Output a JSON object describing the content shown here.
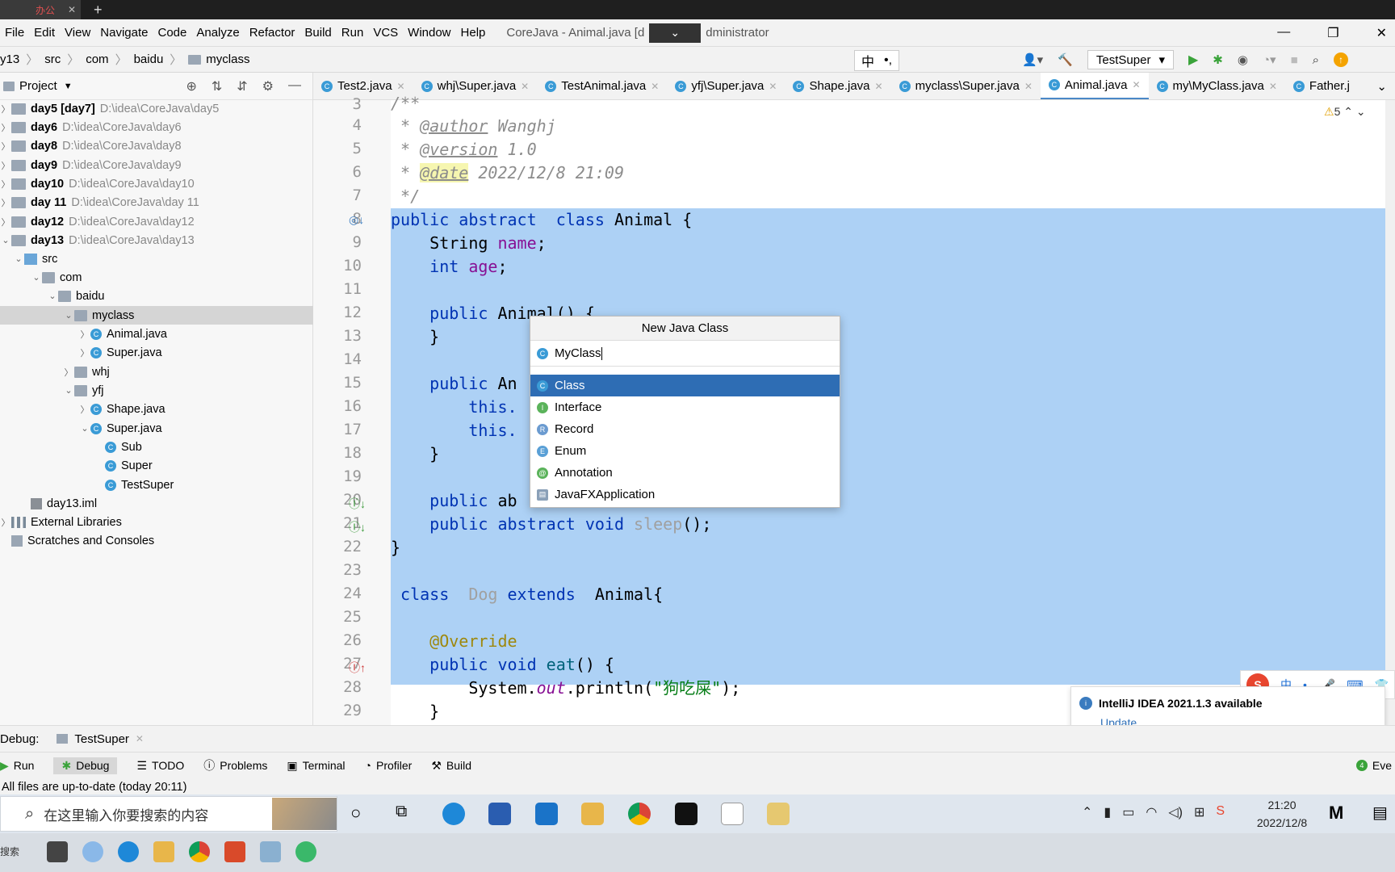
{
  "browser": {
    "tab_label": "办公",
    "new_tab": "+"
  },
  "menu": {
    "items": [
      "File",
      "Edit",
      "View",
      "Navigate",
      "Code",
      "Analyze",
      "Refactor",
      "Build",
      "Run",
      "VCS",
      "Window",
      "Help"
    ],
    "window_title_left": "CoreJava - Animal.java [d",
    "window_title_right": "dministrator"
  },
  "nav": {
    "breadcrumb": [
      "y13",
      "src",
      "com",
      "baidu",
      "myclass"
    ],
    "ime_zh": "中",
    "ime_punct": "•,",
    "run_config": "TestSuper"
  },
  "project": {
    "title": "Project",
    "tree": [
      {
        "name": "day5 [day7]",
        "path": "D:\\idea\\CoreJava\\day5",
        "bold": true
      },
      {
        "name": "day6",
        "path": "D:\\idea\\CoreJava\\day6",
        "bold": true
      },
      {
        "name": "day8",
        "path": "D:\\idea\\CoreJava\\day8",
        "bold": true
      },
      {
        "name": "day9",
        "path": "D:\\idea\\CoreJava\\day9",
        "bold": true
      },
      {
        "name": "day10",
        "path": "D:\\idea\\CoreJava\\day10",
        "bold": true
      },
      {
        "name": "day 11",
        "path": "D:\\idea\\CoreJava\\day 11",
        "bold": true
      },
      {
        "name": "day12",
        "path": "D:\\idea\\CoreJava\\day12",
        "bold": true
      },
      {
        "name": "day13",
        "path": "D:\\idea\\CoreJava\\day13",
        "bold": true
      },
      {
        "name": "src"
      },
      {
        "name": "com"
      },
      {
        "name": "baidu"
      },
      {
        "name": "myclass"
      },
      {
        "name": "Animal.java"
      },
      {
        "name": "Super.java"
      },
      {
        "name": "whj"
      },
      {
        "name": "yfj"
      },
      {
        "name": "Shape.java"
      },
      {
        "name": "Super.java"
      },
      {
        "name": "Sub"
      },
      {
        "name": "Super"
      },
      {
        "name": "TestSuper"
      },
      {
        "name": "day13.iml"
      },
      {
        "name": "External Libraries"
      },
      {
        "name": "Scratches and Consoles"
      }
    ]
  },
  "tabs": [
    "Test2.java",
    "whj\\Super.java",
    "TestAnimal.java",
    "yfj\\Super.java",
    "Shape.java",
    "myclass\\Super.java",
    "Animal.java",
    "my\\MyClass.java",
    "Father.j"
  ],
  "editor": {
    "warning_count": "5",
    "line_numbers": [
      "3",
      "4",
      "5",
      "6",
      "7",
      "8",
      "9",
      "10",
      "11",
      "12",
      "13",
      "14",
      "15",
      "16",
      "17",
      "18",
      "19",
      "20",
      "21",
      "22",
      "23",
      "24",
      "25",
      "26",
      "27",
      "28",
      "29"
    ],
    "c3": "/**",
    "c4a": " * ",
    "c4tag": "@author",
    "c4b": " Wanghj",
    "c5a": " * ",
    "c5tag": "@version",
    "c5b": " 1.0",
    "c6a": " * ",
    "c6tag": "@date",
    "c6b": " 2022/12/8 21:09",
    "c7": " */",
    "l8kw": "public abstract  class",
    "l8rest": " Animal {",
    "l9a": "    String ",
    "l9b": "name",
    "l9c": ";",
    "l10a": "    int ",
    "l10b": "age",
    "l10c": ";",
    "l12kw": "    public",
    "l12rest": " Animal() {",
    "l13": "    }",
    "l15kw": "    public",
    "l15rest": " An",
    "l16": "        this.",
    "l17": "        this.",
    "l18": "    }",
    "l20kw": "    public",
    "l20rest": " ab",
    "l21kw": "    public abstract void",
    "l21b": " sleep",
    "l21c": "();",
    "l22": "}",
    "l24kw": " class",
    "l24b": "  Dog",
    "l24kw2": " extends",
    "l24c": "  Animal{",
    "l26": "    @Override",
    "l27kw": "    public void",
    "l27b": " eat",
    "l27c": "() {",
    "l28a": "        System.",
    "l28b": "out",
    "l28c": ".println(",
    "l28d": "\"狗吃屎\"",
    "l28e": ");",
    "l29": "    }"
  },
  "popup": {
    "title": "New Java Class",
    "input_value": "MyClass",
    "items": [
      "Class",
      "Interface",
      "Record",
      "Enum",
      "Annotation",
      "JavaFXApplication"
    ]
  },
  "notification": {
    "title": "IntelliJ IDEA 2021.1.3 available",
    "link": "Update..."
  },
  "ime_bar": {
    "zh": "中"
  },
  "debug": {
    "label": "Debug:",
    "tab": "TestSuper"
  },
  "toolwindows": [
    "Run",
    "Debug",
    "TODO",
    "Problems",
    "Terminal",
    "Profiler",
    "Build"
  ],
  "event_log": "Eve",
  "status": "All files are up-to-date (today 20:11)",
  "taskbar": {
    "search_placeholder": "在这里输入你要搜索的内容",
    "time": "21:20",
    "date": "2022/12/8",
    "tray_label": "搜索"
  },
  "colors": {
    "selection": "#add1f5",
    "accent": "#2e6db4",
    "keyword": "#0033b3",
    "field": "#871094"
  }
}
